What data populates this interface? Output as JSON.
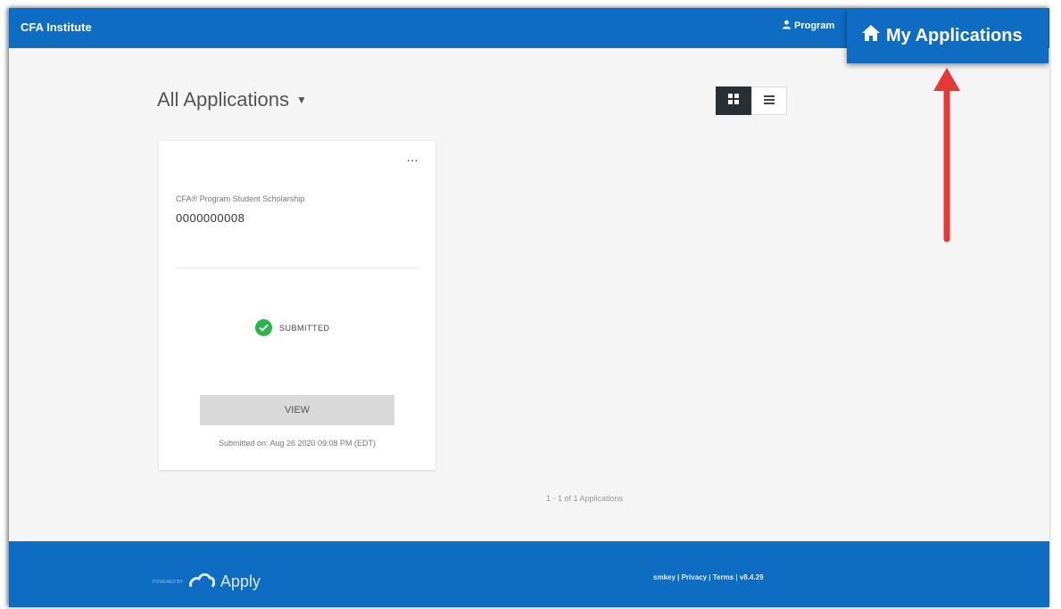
{
  "header": {
    "brand": "CFA Institute",
    "program_label": "Program",
    "my_applications_label": "My Applications"
  },
  "main": {
    "title": "All Applications",
    "view_toggle": [
      "grid",
      "list"
    ]
  },
  "card": {
    "more_label": "…",
    "program_name": "CFA® Program Student Scholarship",
    "application_id": "0000000008",
    "status": "SUBMITTED",
    "view_button": "VIEW",
    "submitted_on": "Submitted on: Aug 26 2020 09:08 PM (EDT)"
  },
  "pagination": "1 - 1 of 1 Applications",
  "footer": {
    "powered_by": "POWERED BY",
    "apply_label": "Apply",
    "links": "smkey | Privacy | Terms | v8.4.29"
  },
  "colors": {
    "brand_blue": "#0e6dc2",
    "success_green": "#2db34a",
    "arrow_red": "#e53935"
  },
  "icons": [
    "person-icon",
    "home-icon",
    "grid-icon",
    "list-icon",
    "check-icon",
    "cloud-icon"
  ]
}
